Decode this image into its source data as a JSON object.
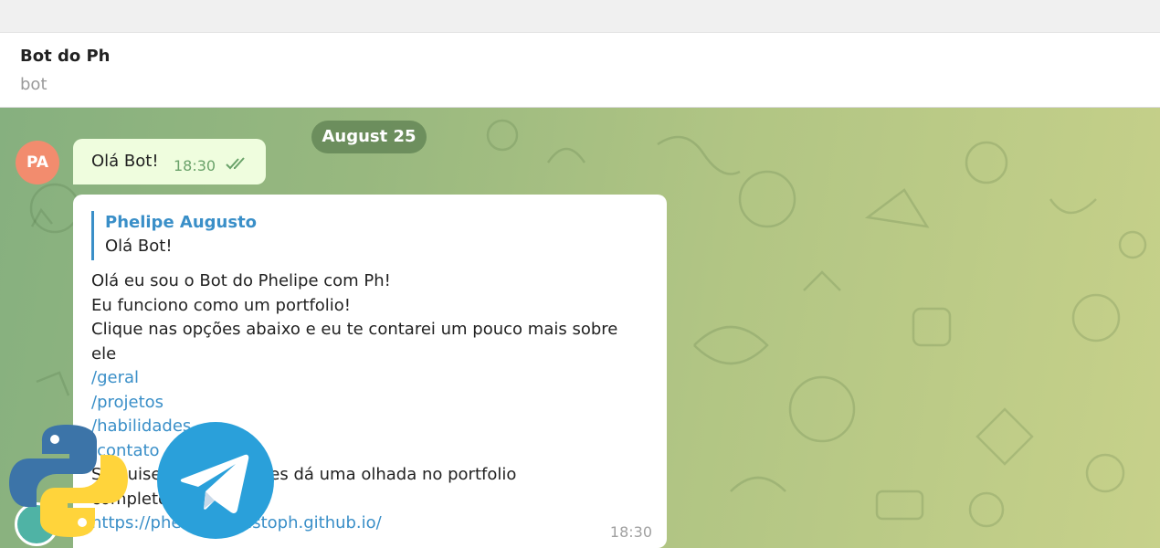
{
  "chat": {
    "title": "Bot do Ph",
    "subtitle": "bot"
  },
  "date_separator": "August 25",
  "incoming": {
    "avatar_initials": "PA",
    "text": "Olá Bot!",
    "time": "18:30"
  },
  "bot_reply": {
    "quoted_name": "Phelipe Augusto",
    "quoted_text": "Olá Bot!",
    "lines": [
      "Olá eu sou o Bot do Phelipe com Ph!",
      "Eu funciono como um portfolio!",
      "Clique nas opções abaixo e eu te contarei um pouco mais sobre",
      "ele"
    ],
    "commands": [
      "/geral",
      "/projetos",
      "/habilidades",
      "/contato"
    ],
    "footer_line1": "Se quiser mais detalhes dá uma olhada no portfolio",
    "footer_line2": "completo",
    "url": "https://phelipeaugustoph.github.io/",
    "time": "18:30"
  },
  "colors": {
    "accent": "#3a8fc8",
    "bubble_out": "#effdde",
    "avatar": "#f28c6e"
  }
}
